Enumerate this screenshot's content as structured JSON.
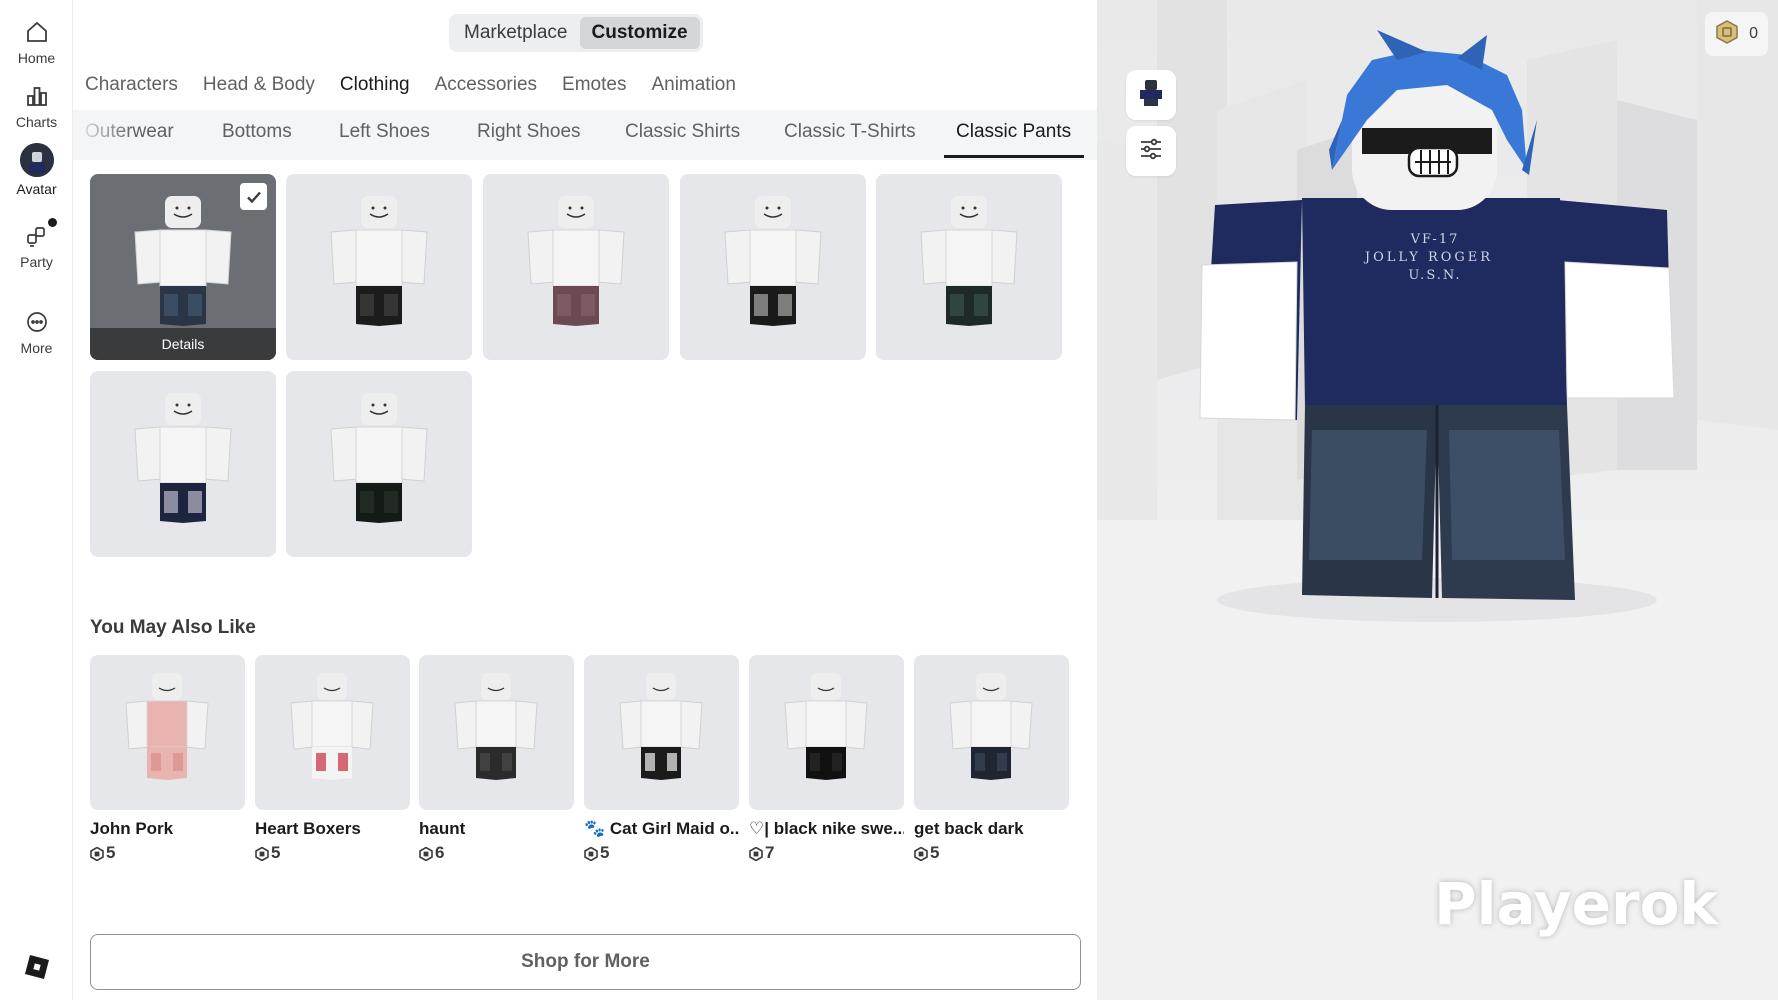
{
  "rail": {
    "items": [
      {
        "label": "Home",
        "icon": "home-icon"
      },
      {
        "label": "Charts",
        "icon": "charts-icon"
      },
      {
        "label": "Avatar",
        "icon": "avatar-icon"
      },
      {
        "label": "Party",
        "icon": "party-icon"
      },
      {
        "label": "More",
        "icon": "more-icon"
      }
    ]
  },
  "top_switch": {
    "marketplace": "Marketplace",
    "customize": "Customize",
    "active": "Customize"
  },
  "categories": [
    "Characters",
    "Head & Body",
    "Clothing",
    "Accessories",
    "Emotes",
    "Animation"
  ],
  "active_category": "Clothing",
  "subcategories": [
    "Outerwear",
    "Bottoms",
    "Left Shoes",
    "Right Shoes",
    "Classic Shirts",
    "Classic T-Shirts",
    "Classic Pants"
  ],
  "active_subcategory": "Classic Pants",
  "owned_items": {
    "count": 7,
    "selected_index": 0,
    "details_label": "Details"
  },
  "recommendations": {
    "title": "You May Also Like",
    "items": [
      {
        "name": "John Pork",
        "price": "5"
      },
      {
        "name": "Heart Boxers",
        "price": "5"
      },
      {
        "name": "haunt",
        "price": "6"
      },
      {
        "name": "🐾 Cat Girl Maid o...",
        "price": "5"
      },
      {
        "name": "♡|  black nike swe...",
        "price": "7"
      },
      {
        "name": "get back dark",
        "price": "5"
      }
    ]
  },
  "shop_button": "Shop for More",
  "viewport": {
    "robux_balance": "0",
    "watermark": "Playerok",
    "shirt_text": "VF-17 JOLLY ROGER U.S.N."
  },
  "colors": {
    "accent_dark": "#1b1b1b",
    "card_bg": "#e5e7ea",
    "selected_card_bg": "#6b6e72",
    "shirt_navy": "#1f2a5e",
    "hair_blue": "#3a78d8"
  }
}
